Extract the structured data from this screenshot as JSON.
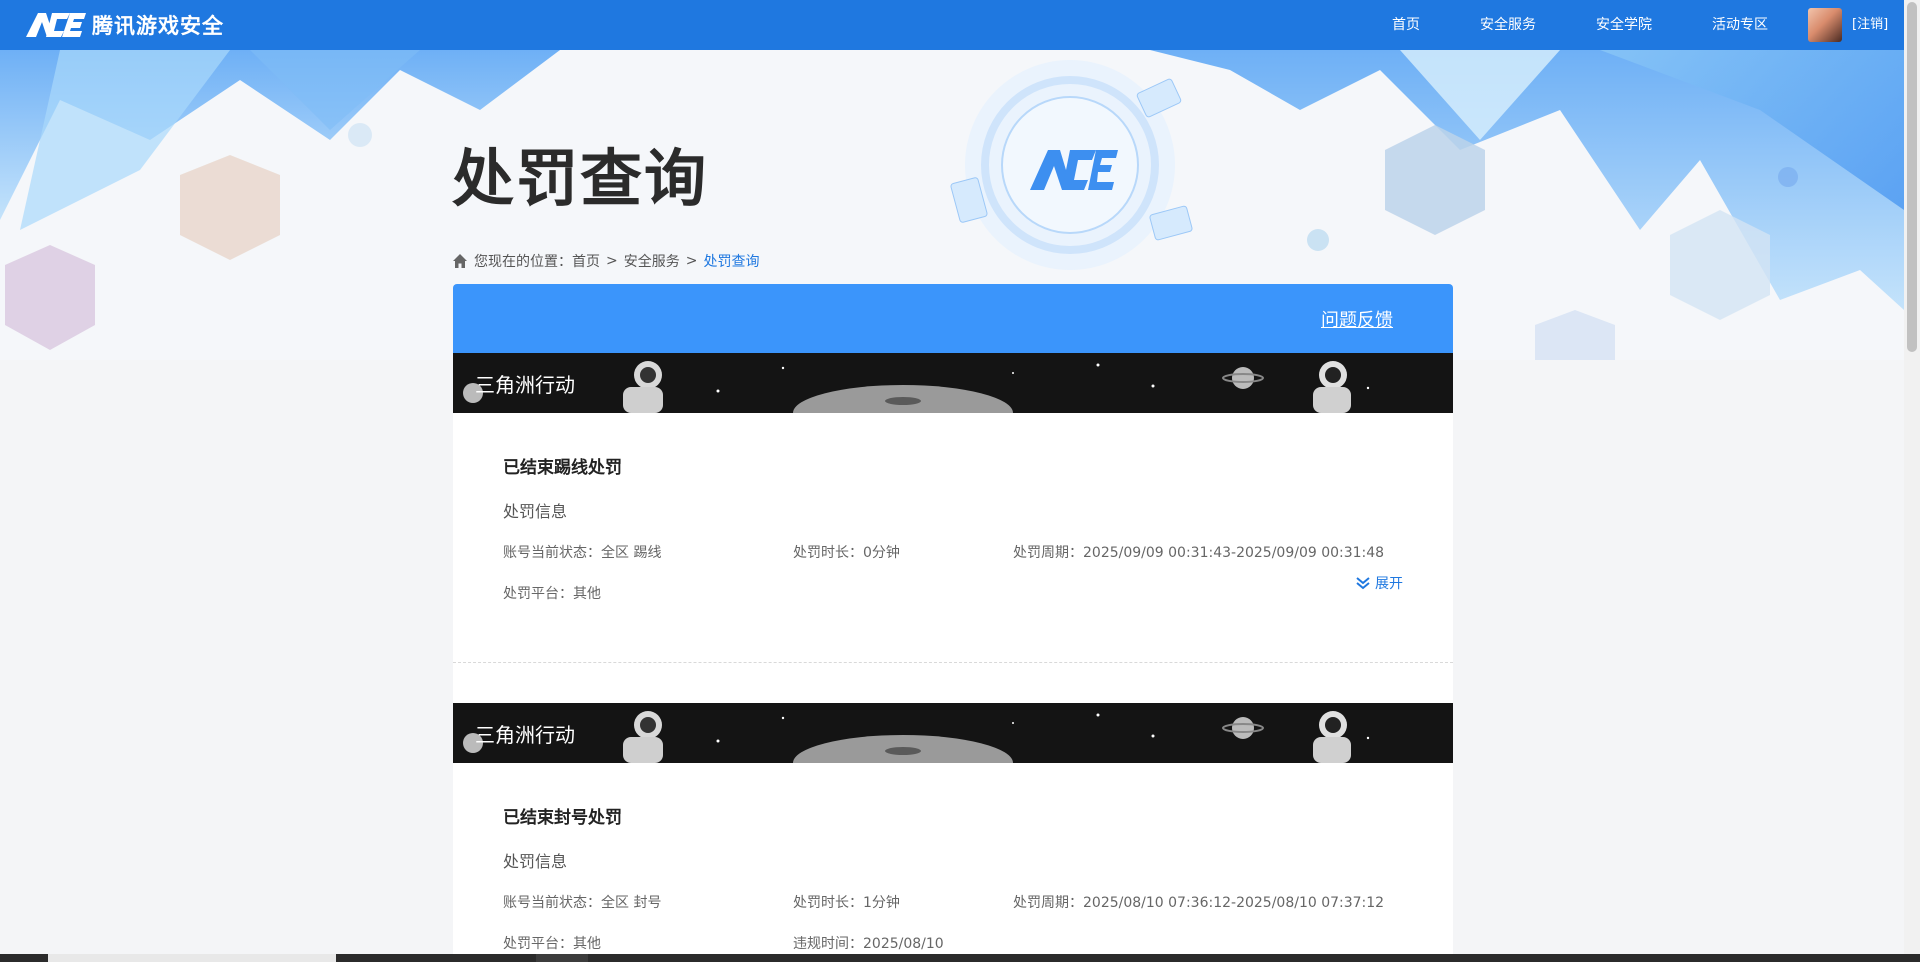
{
  "brand": {
    "logo_text": "腾讯游戏安全",
    "logo_icon": "ace-logo-icon",
    "color": "#1f78e0"
  },
  "nav": {
    "home": "首页",
    "security_service": "安全服务",
    "academy": "安全学院",
    "events": "活动专区",
    "logout": "[注销]"
  },
  "page": {
    "title": "处罚查询"
  },
  "breadcrumb": {
    "prefix": "您现在的位置：",
    "home": "首页",
    "sep": ">",
    "service": "安全服务",
    "current": "处罚查询"
  },
  "panel": {
    "feedback": "问题反馈",
    "header_color": "#3b95fb"
  },
  "records": [
    {
      "game": "三角洲行动",
      "title": "已结束踢线处罚",
      "subtitle": "处罚信息",
      "status": "账号当前状态：全区 踢线",
      "duration": "处罚时长：0分钟",
      "period": "处罚周期：2025/09/09 00:31:43-2025/09/09 00:31:48",
      "platform": "处罚平台：其他",
      "expand": "展开"
    },
    {
      "game": "三角洲行动",
      "title": "已结束封号处罚",
      "subtitle": "处罚信息",
      "status": "账号当前状态：全区 封号",
      "duration": "处罚时长：1分钟",
      "period": "处罚周期：2025/08/10 07:36:12-2025/08/10 07:37:12",
      "platform": "处罚平台：其他",
      "violation_time": "违规时间：2025/08/10"
    }
  ]
}
